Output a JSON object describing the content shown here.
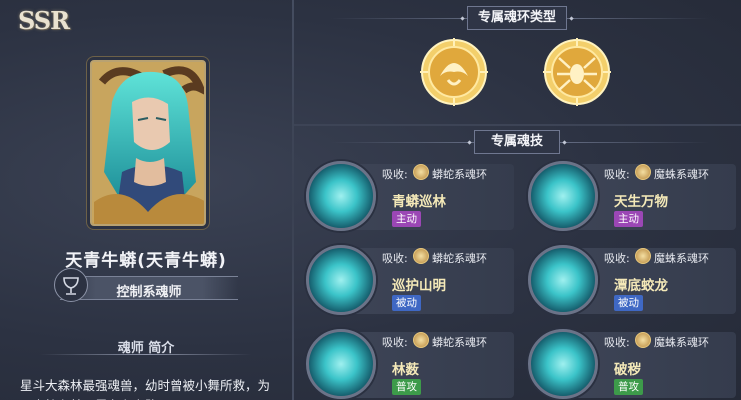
{
  "rarity": "SSR",
  "character": {
    "name": "天青牛蟒(天青牛蟒)",
    "role": "控制系魂师",
    "role_icon": "chalice-icon"
  },
  "intro": {
    "title": "魂师 简介",
    "text": "星斗大森林最强魂兽，幼时曾被小舞所救，为了守护在林区里存在之路"
  },
  "ring_section": {
    "title": "专属魂环类型",
    "rings": [
      {
        "icon": "python-ring-icon"
      },
      {
        "icon": "spider-ring-icon"
      }
    ]
  },
  "skills_section": {
    "title": "专属魂技",
    "source_label": "吸收:",
    "skills": [
      {
        "name": "青蟒巡林",
        "source": "蟒蛇系魂环",
        "tag": "主动",
        "tag_color": "#9b47b5",
        "icon": "green-vine-skill-icon"
      },
      {
        "name": "天生万物",
        "source": "魔蛛系魂环",
        "tag": "主动",
        "tag_color": "#9b47b5",
        "icon": "tentacle-skill-icon"
      },
      {
        "name": "巡护山明",
        "source": "蟒蛇系魂环",
        "tag": "被动",
        "tag_color": "#3f68c4",
        "icon": "eye-skill-icon"
      },
      {
        "name": "潭底蛟龙",
        "source": "魔蛛系魂环",
        "tag": "被动",
        "tag_color": "#3f68c4",
        "icon": "dragon-skill-icon"
      },
      {
        "name": "林薮",
        "source": "蟒蛇系魂环",
        "tag": "普攻",
        "tag_color": "#3d9b4a",
        "icon": "leaf-orb-skill-icon"
      },
      {
        "name": "破秽",
        "source": "魔蛛系魂环",
        "tag": "普攻",
        "tag_color": "#3d9b4a",
        "icon": "light-orb-skill-icon"
      }
    ]
  }
}
